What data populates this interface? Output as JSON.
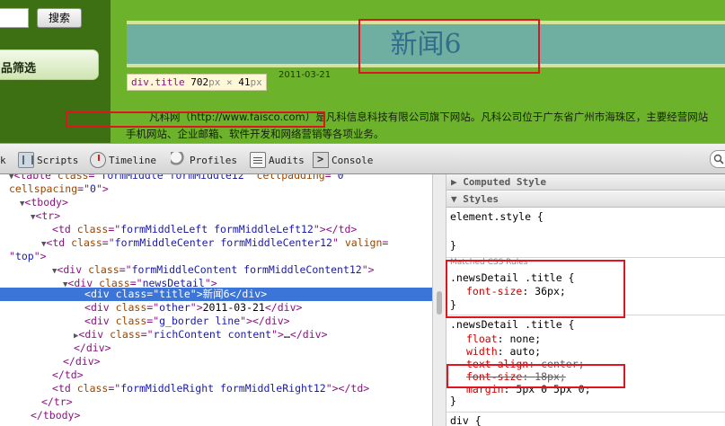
{
  "page": {
    "search_button": "搜索",
    "filter_label": "品筛选",
    "news_title": "新闻6",
    "news_date": "2011-03-21",
    "tooltip": {
      "tag": "div.title",
      "width": "702",
      "height": "41",
      "unit": "px",
      "sep": "×"
    },
    "paragraph_line1": "凡科网（http://www.faisco.com）是凡科信息科技有限公司旗下网站。凡科公司位于广东省广州市海珠区，主要经营网站",
    "paragraph_line2": "手机网站、企业邮箱、软件开发和网络营销等各项业务。"
  },
  "toolbar": {
    "partial_tab": "k",
    "tabs": [
      "Scripts",
      "Timeline",
      "Profiles",
      "Audits",
      "Console"
    ]
  },
  "dom": {
    "line0": {
      "tag": "table",
      "attr1": "class",
      "val1": "formMiddle formMiddle12",
      "attr2": "cellpadding",
      "val2": "0"
    },
    "line1": {
      "attr": "cellspacing",
      "val": "0"
    },
    "tbody_open": "tbody",
    "tr_open": "tr",
    "td_left": {
      "tag": "td",
      "attr": "class",
      "val": "formMiddleLeft formMiddleLeft12",
      "close": "td"
    },
    "td_center": {
      "tag": "td",
      "attr1": "class",
      "val1": "formMiddleCenter formMiddleCenter12",
      "attr2": "valign",
      "val2": "top"
    },
    "div_content": {
      "tag": "div",
      "attr": "class",
      "val": "formMiddleContent formMiddleContent12"
    },
    "div_newsdetail": {
      "tag": "div",
      "attr": "class",
      "val": "newsDetail"
    },
    "div_title": {
      "tag": "div",
      "attr": "class",
      "val": "title",
      "text": "新闻6",
      "close": "div"
    },
    "div_other": {
      "tag": "div",
      "attr": "class",
      "val": "other",
      "text": "2011-03-21",
      "close": "div"
    },
    "div_gborder": {
      "tag": "div",
      "attr": "class",
      "val": "g_border line",
      "close": "div"
    },
    "div_rich": {
      "tag": "div",
      "attr": "class",
      "val": "richContent content",
      "text": "…",
      "close": "div"
    },
    "close_div": "div",
    "close_td": "td",
    "td_right": {
      "tag": "td",
      "attr": "class",
      "val": "formMiddleRight formMiddleRight12",
      "close": "td"
    },
    "close_tr": "tr",
    "close_tbody": "tbody"
  },
  "styles": {
    "computed_header": "Computed Style",
    "styles_header": "Styles",
    "element_style": "element.style {",
    "close_brace": "}",
    "matched_label": "Matched CSS Rules",
    "rule1": {
      "selector": ".newsDetail .title {",
      "prop": "font-size",
      "value": "36px;"
    },
    "rule2": {
      "selector": ".newsDetail .title {",
      "props": [
        {
          "prop": "float",
          "value": "none;"
        },
        {
          "prop": "width",
          "value": "auto;"
        },
        {
          "prop": "text-align",
          "value": "center;"
        },
        {
          "prop": "font-size",
          "value": "18px;"
        },
        {
          "prop": "margin",
          "value": "5px 0 5px 0;"
        }
      ]
    },
    "rule3_selector": "div {"
  }
}
